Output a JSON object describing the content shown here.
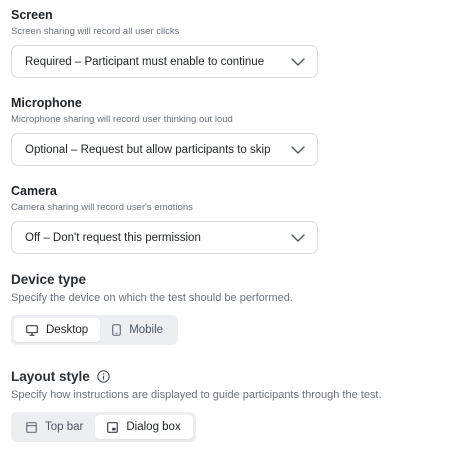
{
  "screen": {
    "label": "Screen",
    "help": "Screen sharing will record all user clicks",
    "value": "Required – Participant must enable to continue"
  },
  "microphone": {
    "label": "Microphone",
    "help": "Microphone sharing will record user thinking out loud",
    "value": "Optional – Request but allow participants to skip"
  },
  "camera": {
    "label": "Camera",
    "help": "Camera sharing will record user's emotions",
    "value": "Off – Don't request this permission"
  },
  "device_type": {
    "label": "Device type",
    "help": "Specify the device on which the test should be performed.",
    "options": [
      {
        "label": "Desktop",
        "icon": "monitor-icon",
        "selected": true
      },
      {
        "label": "Mobile",
        "icon": "phone-icon",
        "selected": false
      }
    ]
  },
  "layout_style": {
    "label": "Layout style",
    "info_icon": "info-icon",
    "help": "Specify how instructions are displayed to guide participants through the test.",
    "options": [
      {
        "label": "Top bar",
        "icon": "top-bar-icon",
        "selected": false
      },
      {
        "label": "Dialog box",
        "icon": "dialog-box-icon",
        "selected": true
      }
    ]
  }
}
